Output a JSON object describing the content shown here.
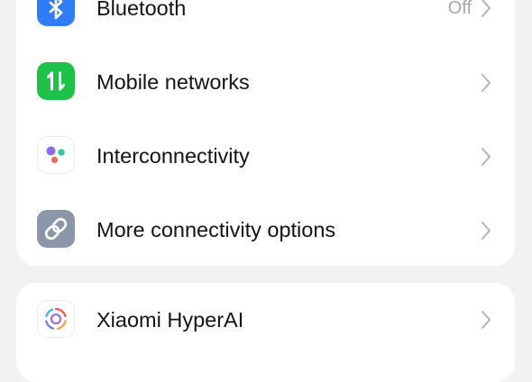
{
  "settings": {
    "rows": [
      {
        "label": "Bluetooth",
        "value": "Off",
        "icon": "bluetooth-icon"
      },
      {
        "label": "Mobile networks",
        "icon": "mobile-networks-icon"
      },
      {
        "label": "Interconnectivity",
        "icon": "interconnectivity-icon"
      },
      {
        "label": "More connectivity options",
        "icon": "link-icon"
      },
      {
        "label": "Xiaomi HyperAI",
        "icon": "hyperai-icon"
      }
    ]
  },
  "colors": {
    "background": "#f2f2f4",
    "card": "#ffffff",
    "bluetooth": "#2f7cf6",
    "mobile_networks": "#1fc248",
    "more_connectivity": "#8b97a8",
    "chevron": "#b4b4b4",
    "value_text": "#a7a7a7"
  }
}
